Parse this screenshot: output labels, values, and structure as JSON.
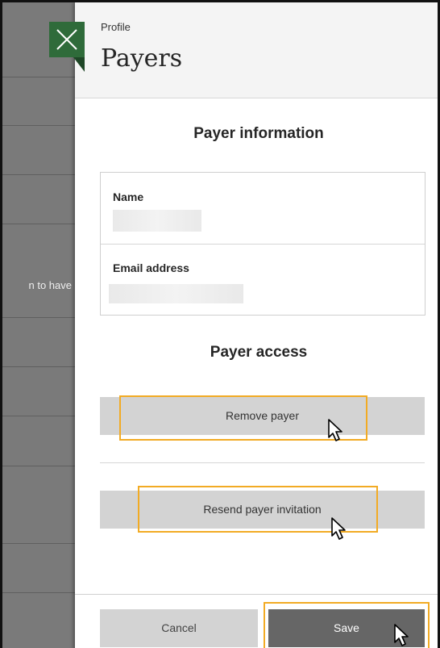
{
  "background": {
    "row_text": "n to have"
  },
  "panel": {
    "breadcrumb": "Profile",
    "title": "Payers",
    "close_icon": "close-icon"
  },
  "payer_information": {
    "heading": "Payer information",
    "name_label": "Name",
    "email_label": "Email address"
  },
  "payer_access": {
    "heading": "Payer access",
    "remove_label": "Remove payer",
    "resend_label": "Resend payer invitation"
  },
  "footer": {
    "cancel_label": "Cancel",
    "save_label": "Save"
  },
  "colors": {
    "close_bg": "#2f6b3a",
    "highlight": "#f2ab24",
    "button_bg": "#d3d3d3",
    "save_bg": "#666666"
  }
}
